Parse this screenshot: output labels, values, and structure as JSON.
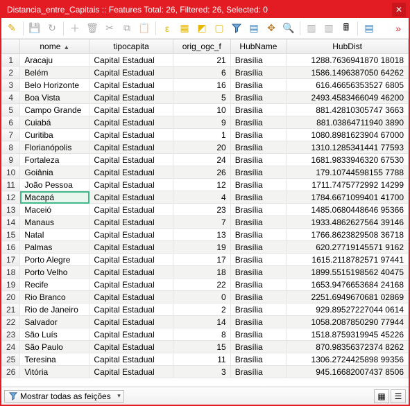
{
  "title": "Distancia_entre_Capitais :: Features Total: 26, Filtered: 26, Selected: 0",
  "columns": [
    "nome",
    "tipocapita",
    "orig_ogc_f",
    "HubName",
    "HubDist"
  ],
  "sort_column": "nome",
  "selected_row": 12,
  "statusbar": {
    "filter_label": "Mostrar todas as feições"
  },
  "rows": [
    {
      "n": 1,
      "nome": "Aracaju",
      "tipo": "Capital Estadual",
      "orig": 21,
      "hub": "Brasília",
      "dist": "1288.7636941870 18018"
    },
    {
      "n": 2,
      "nome": "Belém",
      "tipo": "Capital Estadual",
      "orig": 6,
      "hub": "Brasília",
      "dist": "1586.1496387050 64262"
    },
    {
      "n": 3,
      "nome": "Belo Horizonte",
      "tipo": "Capital Estadual",
      "orig": 16,
      "hub": "Brasília",
      "dist": "616.46656353527 6805"
    },
    {
      "n": 4,
      "nome": "Boa Vista",
      "tipo": "Capital Estadual",
      "orig": 5,
      "hub": "Brasília",
      "dist": "2493.4583466049 46200"
    },
    {
      "n": 5,
      "nome": "Campo Grande",
      "tipo": "Capital Estadual",
      "orig": 10,
      "hub": "Brasília",
      "dist": "881.42810305747 3663"
    },
    {
      "n": 6,
      "nome": "Cuiabá",
      "tipo": "Capital Estadual",
      "orig": 9,
      "hub": "Brasília",
      "dist": "881.03864711940 3890"
    },
    {
      "n": 7,
      "nome": "Curitiba",
      "tipo": "Capital Estadual",
      "orig": 1,
      "hub": "Brasília",
      "dist": "1080.8981623904 67000"
    },
    {
      "n": 8,
      "nome": "Florianópolis",
      "tipo": "Capital Estadual",
      "orig": 20,
      "hub": "Brasília",
      "dist": "1310.1285341441 77593"
    },
    {
      "n": 9,
      "nome": "Fortaleza",
      "tipo": "Capital Estadual",
      "orig": 24,
      "hub": "Brasília",
      "dist": "1681.9833946320 67530"
    },
    {
      "n": 10,
      "nome": "Goiânia",
      "tipo": "Capital Estadual",
      "orig": 26,
      "hub": "Brasília",
      "dist": "179.10744598155 7788"
    },
    {
      "n": 11,
      "nome": "João Pessoa",
      "tipo": "Capital Estadual",
      "orig": 12,
      "hub": "Brasília",
      "dist": "1711.7475772992 14299"
    },
    {
      "n": 12,
      "nome": "Macapá",
      "tipo": "Capital Estadual",
      "orig": 4,
      "hub": "Brasília",
      "dist": "1784.6671099401 41700"
    },
    {
      "n": 13,
      "nome": "Maceió",
      "tipo": "Capital Estadual",
      "orig": 23,
      "hub": "Brasília",
      "dist": "1485.0680448646 95366"
    },
    {
      "n": 14,
      "nome": "Manaus",
      "tipo": "Capital Estadual",
      "orig": 7,
      "hub": "Brasília",
      "dist": "1933.4862627564 39146"
    },
    {
      "n": 15,
      "nome": "Natal",
      "tipo": "Capital Estadual",
      "orig": 13,
      "hub": "Brasília",
      "dist": "1766.8623829508 36718"
    },
    {
      "n": 16,
      "nome": "Palmas",
      "tipo": "Capital Estadual",
      "orig": 19,
      "hub": "Brasília",
      "dist": "620.27719145571 9162"
    },
    {
      "n": 17,
      "nome": "Porto Alegre",
      "tipo": "Capital Estadual",
      "orig": 17,
      "hub": "Brasília",
      "dist": "1615.2118782571 97441"
    },
    {
      "n": 18,
      "nome": "Porto Velho",
      "tipo": "Capital Estadual",
      "orig": 18,
      "hub": "Brasília",
      "dist": "1899.5515198562 40475"
    },
    {
      "n": 19,
      "nome": "Recife",
      "tipo": "Capital Estadual",
      "orig": 22,
      "hub": "Brasília",
      "dist": "1653.9476653684 24168"
    },
    {
      "n": 20,
      "nome": "Rio Branco",
      "tipo": "Capital Estadual",
      "orig": 0,
      "hub": "Brasília",
      "dist": "2251.6949670681 02869"
    },
    {
      "n": 21,
      "nome": "Rio de Janeiro",
      "tipo": "Capital Estadual",
      "orig": 2,
      "hub": "Brasília",
      "dist": "929.89527227044 0614"
    },
    {
      "n": 22,
      "nome": "Salvador",
      "tipo": "Capital Estadual",
      "orig": 14,
      "hub": "Brasília",
      "dist": "1058.2087850290 77944"
    },
    {
      "n": 23,
      "nome": "São Luís",
      "tipo": "Capital Estadual",
      "orig": 8,
      "hub": "Brasília",
      "dist": "1518.8759319945 45226"
    },
    {
      "n": 24,
      "nome": "São Paulo",
      "tipo": "Capital Estadual",
      "orig": 15,
      "hub": "Brasília",
      "dist": "870.98356372374 8262"
    },
    {
      "n": 25,
      "nome": "Teresina",
      "tipo": "Capital Estadual",
      "orig": 11,
      "hub": "Brasília",
      "dist": "1306.2724425898 99356"
    },
    {
      "n": 26,
      "nome": "Vitória",
      "tipo": "Capital Estadual",
      "orig": 3,
      "hub": "Brasília",
      "dist": "945.16682007437 8506"
    }
  ]
}
